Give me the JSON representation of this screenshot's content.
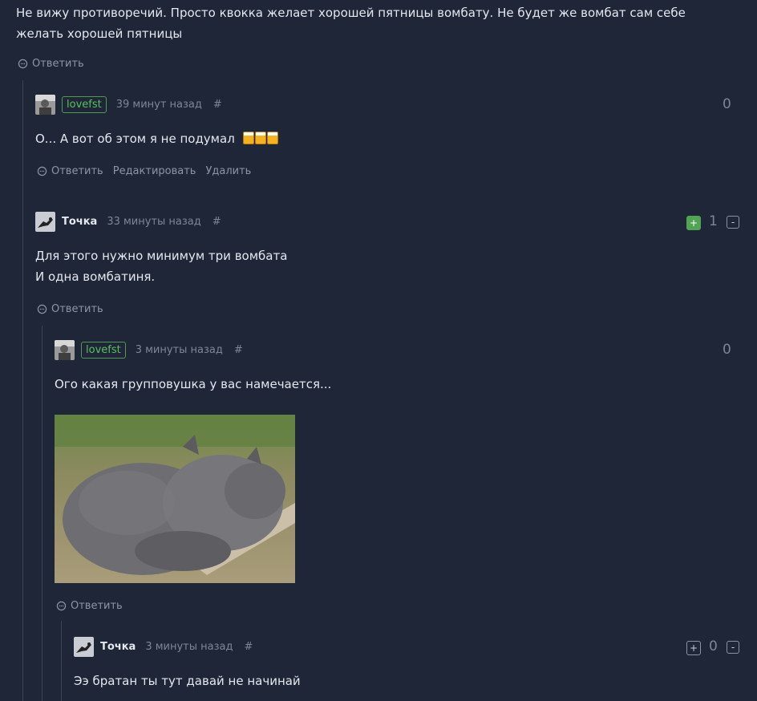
{
  "top": {
    "text_line1": "Не вижу противоречий. Просто квокка желает хорошей пятницы вомбату. Не будет же вомбат сам себе",
    "text_line2": "желать хорошей пятницы",
    "reply": "Ответить"
  },
  "comments": [
    {
      "user": "lovefst",
      "time": "39 минут назад",
      "hash": "#",
      "score": "0",
      "text": "О... А вот об этом я не подумал",
      "emoji": "beer-mugs",
      "reply": "Ответить",
      "edit": "Редактировать",
      "delete": "Удалить"
    },
    {
      "user": "Точка",
      "time": "33 минуты назад",
      "hash": "#",
      "score": "1",
      "plus": "+",
      "minus": "-",
      "text_line1": "Для этого нужно минимум три вомбата",
      "text_line2": "И одна вомбатиня.",
      "reply": "Ответить"
    },
    {
      "user": "lovefst",
      "time": "3 минуты назад",
      "hash": "#",
      "score": "0",
      "text": "Ого какая групповушка у вас намечается...",
      "image": "wombats-photo",
      "reply": "Ответить"
    },
    {
      "user": "Точка",
      "time": "3 минуты назад",
      "hash": "#",
      "score": "0",
      "plus": "+",
      "minus": "-",
      "text": "Ээ братан ты тут давай не начинай"
    }
  ],
  "colors": {
    "background": "#1f2637",
    "accent_green": "#4fa552",
    "muted": "#7d8697"
  }
}
